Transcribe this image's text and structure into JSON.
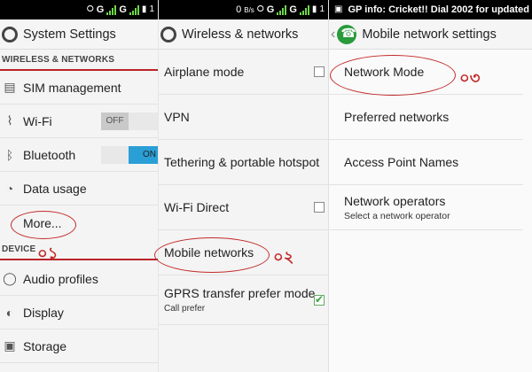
{
  "panel1": {
    "status": {
      "icons": [
        "vibrate-icon",
        "signal-g-1",
        "signal-g-2",
        "sim-icon"
      ],
      "g_label": "G",
      "extra": "1"
    },
    "header_title": "System Settings",
    "section_wireless": "WIRELESS & NETWORKS",
    "items": [
      {
        "label": "SIM management",
        "icon": "sim-icon"
      },
      {
        "label": "Wi-Fi",
        "icon": "wifi-icon",
        "toggle": "OFF"
      },
      {
        "label": "Bluetooth",
        "icon": "bluetooth-icon",
        "toggle": "ON"
      },
      {
        "label": "Data usage",
        "icon": "data-usage-icon"
      },
      {
        "label": "More...",
        "icon": ""
      }
    ],
    "annotation_1": "০১",
    "section_device": "DEVICE",
    "device_items": [
      {
        "label": "Audio profiles",
        "icon": "audio-icon"
      },
      {
        "label": "Display",
        "icon": "display-icon"
      },
      {
        "label": "Storage",
        "icon": "storage-icon"
      }
    ]
  },
  "panel2": {
    "status": {
      "data_rate": "0",
      "unit": "B/s"
    },
    "header_title": "Wireless & networks",
    "items": [
      {
        "label": "Airplane mode",
        "checkbox": false
      },
      {
        "label": "VPN"
      },
      {
        "label": "Tethering & portable hotspot"
      },
      {
        "label": "Wi-Fi Direct",
        "checkbox": false
      },
      {
        "label": "Mobile networks"
      },
      {
        "label": "GPRS transfer prefer mode",
        "sub": "Call prefer",
        "checkbox": true
      }
    ],
    "annotation_2": "০২"
  },
  "panel3": {
    "status": {
      "text": "GP info: Cricket!! Dial 2002 for updated"
    },
    "header_title": "Mobile network settings",
    "items": [
      {
        "label": "Network Mode"
      },
      {
        "label": "Preferred networks"
      },
      {
        "label": "Access Point Names"
      },
      {
        "label": "Network operators",
        "sub": "Select a network operator"
      }
    ],
    "annotation_3": "০৩"
  },
  "colors": {
    "accent_red": "#b8242a",
    "toggle_on": "#2a9fd6",
    "annotation": "#c42a2a"
  }
}
